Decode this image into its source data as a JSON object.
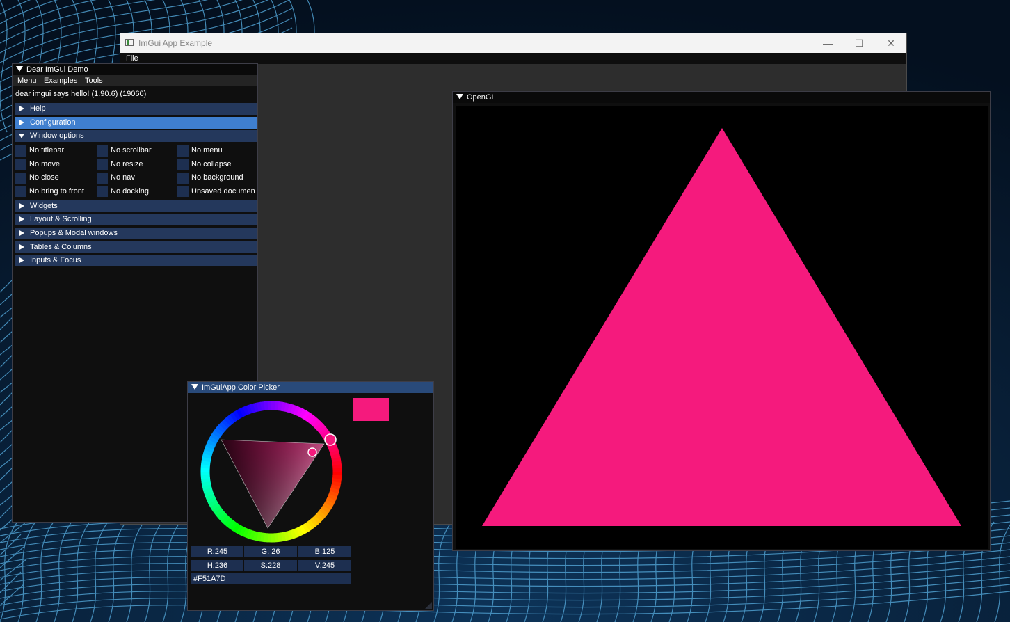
{
  "host": {
    "title": "ImGui App Example",
    "menu": [
      "File"
    ],
    "controls": {
      "minimize": "—",
      "maximize": "☐",
      "close": "✕"
    }
  },
  "demo": {
    "title": "Dear ImGui Demo",
    "menubar": [
      "Menu",
      "Examples",
      "Tools"
    ],
    "hello": "dear imgui says hello! (1.90.6) (19060)",
    "headers_top": [
      "Help",
      "Configuration",
      "Window options"
    ],
    "options": [
      [
        "No titlebar",
        "No scrollbar",
        "No menu"
      ],
      [
        "No move",
        "No resize",
        "No collapse"
      ],
      [
        "No close",
        "No nav",
        "No background"
      ],
      [
        "No bring to front",
        "No docking",
        "Unsaved documen"
      ]
    ],
    "headers_bottom": [
      "Widgets",
      "Layout & Scrolling",
      "Popups & Modal windows",
      "Tables & Columns",
      "Inputs & Focus"
    ]
  },
  "opengl": {
    "title": "OpenGL",
    "triangle_color": "#f51a7d"
  },
  "picker": {
    "title": "ImGuiApp Color Picker",
    "color": "#f51a7d",
    "rgb": [
      "R:245",
      "G: 26",
      "B:125"
    ],
    "hsv": [
      "H:236",
      "S:228",
      "V:245"
    ],
    "hex": "#F51A7D"
  }
}
